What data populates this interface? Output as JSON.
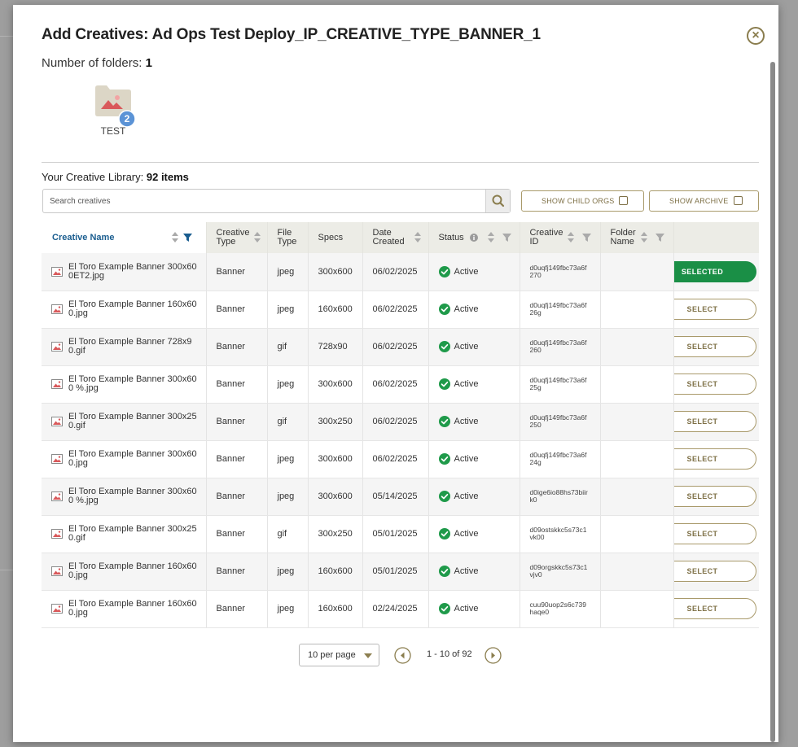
{
  "modal": {
    "title": "Add Creatives: Ad Ops Test Deploy_IP_CREATIVE_TYPE_BANNER_1",
    "close_label": "×"
  },
  "folders": {
    "count_label": "Number of folders:",
    "count": "1",
    "items": [
      {
        "name": "TEST",
        "badge": "2"
      }
    ]
  },
  "library": {
    "label": "Your Creative Library:",
    "count": "92 items"
  },
  "search": {
    "placeholder": "Search creatives",
    "value": ""
  },
  "toggles": {
    "show_child_orgs": "SHOW CHILD ORGS",
    "show_archive": "SHOW ARCHIVE"
  },
  "table": {
    "headers": {
      "creative_name": "Creative Name",
      "creative_type": "Creative Type",
      "file_type": "File Type",
      "specs": "Specs",
      "date_created": "Date Created",
      "status": "Status",
      "creative_id": "Creative ID",
      "folder_name": "Folder Name"
    },
    "rows": [
      {
        "name": "El Toro Example Banner 300x600ET2.jpg",
        "type": "Banner",
        "file": "jpeg",
        "specs": "300x600",
        "date": "06/02/2025",
        "status": "Active",
        "id": "d0uqfj149fbc73a6f270",
        "folder": "",
        "action": "SELECTED",
        "selected": true
      },
      {
        "name": "El Toro Example Banner 160x600.jpg",
        "type": "Banner",
        "file": "jpeg",
        "specs": "160x600",
        "date": "06/02/2025",
        "status": "Active",
        "id": "d0uqfj149fbc73a6f26g",
        "folder": "",
        "action": "SELECT",
        "selected": false
      },
      {
        "name": "El Toro Example Banner 728x90.gif",
        "type": "Banner",
        "file": "gif",
        "specs": "728x90",
        "date": "06/02/2025",
        "status": "Active",
        "id": "d0uqfj149fbc73a6f260",
        "folder": "",
        "action": "SELECT",
        "selected": false
      },
      {
        "name": "El Toro Example Banner 300x600 %.jpg",
        "type": "Banner",
        "file": "jpeg",
        "specs": "300x600",
        "date": "06/02/2025",
        "status": "Active",
        "id": "d0uqfj149fbc73a6f25g",
        "folder": "",
        "action": "SELECT",
        "selected": false
      },
      {
        "name": "El Toro Example Banner 300x250.gif",
        "type": "Banner",
        "file": "gif",
        "specs": "300x250",
        "date": "06/02/2025",
        "status": "Active",
        "id": "d0uqfj149fbc73a6f250",
        "folder": "",
        "action": "SELECT",
        "selected": false
      },
      {
        "name": "El Toro Example Banner 300x600.jpg",
        "type": "Banner",
        "file": "jpeg",
        "specs": "300x600",
        "date": "06/02/2025",
        "status": "Active",
        "id": "d0uqfj149fbc73a6f24g",
        "folder": "",
        "action": "SELECT",
        "selected": false
      },
      {
        "name": "El Toro Example Banner 300x600 %.jpg",
        "type": "Banner",
        "file": "jpeg",
        "specs": "300x600",
        "date": "05/14/2025",
        "status": "Active",
        "id": "d0ige6io88hs73biirk0",
        "folder": "",
        "action": "SELECT",
        "selected": false
      },
      {
        "name": "El Toro Example Banner 300x250.gif",
        "type": "Banner",
        "file": "gif",
        "specs": "300x250",
        "date": "05/01/2025",
        "status": "Active",
        "id": "d09ostskkc5s73c1vk00",
        "folder": "",
        "action": "SELECT",
        "selected": false
      },
      {
        "name": "El Toro Example Banner 160x600.jpg",
        "type": "Banner",
        "file": "jpeg",
        "specs": "160x600",
        "date": "05/01/2025",
        "status": "Active",
        "id": "d09orgskkc5s73c1vjv0",
        "folder": "",
        "action": "SELECT",
        "selected": false
      },
      {
        "name": "El Toro Example Banner 160x600.jpg",
        "type": "Banner",
        "file": "jpeg",
        "specs": "160x600",
        "date": "02/24/2025",
        "status": "Active",
        "id": "cuu90uop2s6c739haqe0",
        "folder": "",
        "action": "SELECT",
        "selected": false
      }
    ]
  },
  "pagination": {
    "per_page": "10 per page",
    "range": "1 - 10 of 92"
  },
  "colors": {
    "accent_gold": "#8a7d4e",
    "link_blue": "#1a5d8f",
    "selected_green": "#1a8f46",
    "status_green": "#1f9a4a",
    "badge_blue": "#5b93d6"
  },
  "icons": {
    "close": "close-icon",
    "folder": "folder-icon",
    "search": "search-icon",
    "sort": "sort-icon",
    "filter": "filter-icon",
    "info": "info-icon",
    "status": "check-circle-icon",
    "thumbnail": "image-icon",
    "prev": "chevron-left-icon",
    "next": "chevron-right-icon"
  }
}
